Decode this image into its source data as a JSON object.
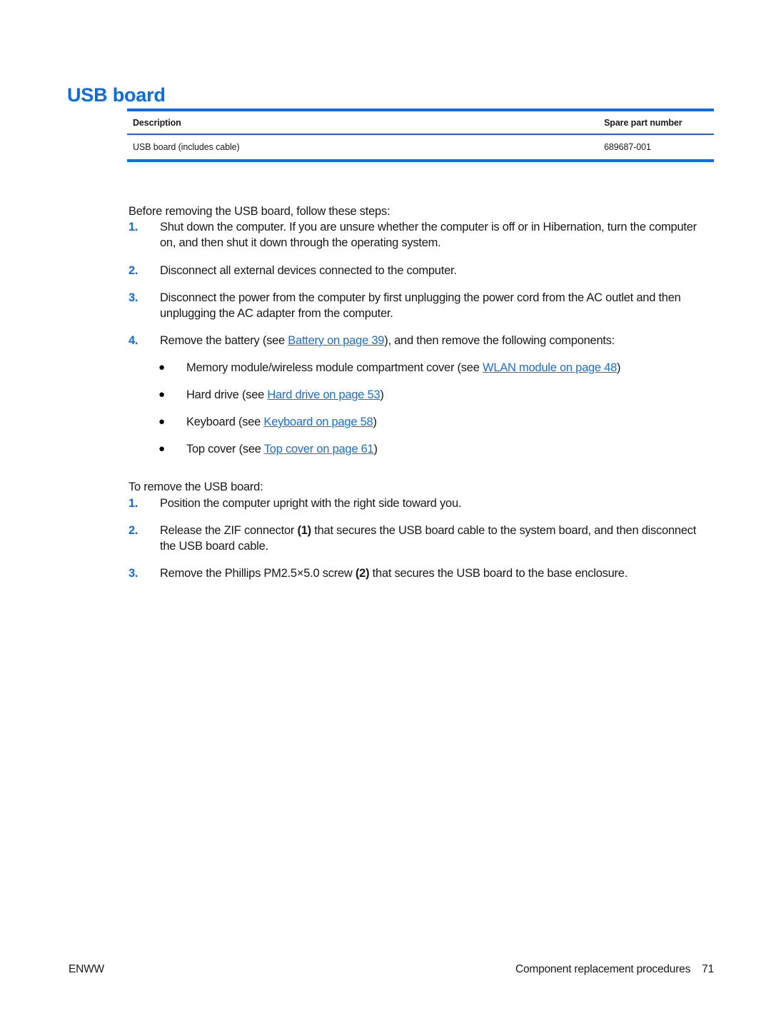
{
  "document": {
    "heading": "USB board"
  },
  "parts_table": {
    "columns": [
      "Description",
      "Spare part number"
    ],
    "rows": [
      {
        "description": "USB board (includes cable)",
        "spare_part_number": "689687-001"
      }
    ]
  },
  "prereq": {
    "intro": "Before removing the USB board, follow these steps:",
    "steps": [
      {
        "number": "1.",
        "text": "Shut down the computer. If you are unsure whether the computer is off or in Hibernation, turn the computer on, and then shut it down through the operating system."
      },
      {
        "number": "2.",
        "text": "Disconnect all external devices connected to the computer."
      },
      {
        "number": "3.",
        "text": "Disconnect the power from the computer by first unplugging the power cord from the AC outlet and then unplugging the AC adapter from the computer."
      },
      {
        "number": "4.",
        "text_before": "Remove the battery (see ",
        "link": "Battery on page 39",
        "text_after": "), and then remove the following components:"
      }
    ],
    "bullets": [
      {
        "marker": "●",
        "text_before": "Memory module/wireless module compartment cover (see ",
        "link": "WLAN module on page 48",
        "text_after": ")"
      },
      {
        "marker": "●",
        "text_before": "Hard drive (see ",
        "link": "Hard drive on page 53",
        "text_after": ")"
      },
      {
        "marker": "●",
        "text_before": "Keyboard (see ",
        "link": "Keyboard on page 58",
        "text_after": ")"
      },
      {
        "marker": "●",
        "text_before": "Top cover (see ",
        "link": "Top cover on page 61",
        "text_after": ")"
      }
    ]
  },
  "procedure": {
    "intro": "To remove the USB board:",
    "steps": [
      {
        "number": "1.",
        "text": "Position the computer upright with the right side toward you."
      },
      {
        "number": "2.",
        "text_before": "Release the ZIF connector ",
        "callout": "(1)",
        "text_after": " that secures the USB board cable to the system board, and then disconnect the USB board cable."
      },
      {
        "number": "3.",
        "text_before": "Remove the Phillips PM2.5×5.0 screw ",
        "callout": "(2)",
        "text_after": " that secures the USB board to the base enclosure."
      }
    ]
  },
  "footer": {
    "left": "ENWW",
    "section": "Component replacement procedures",
    "page_number": "71"
  },
  "colors": {
    "accent_blue": "#0B6BE8",
    "link_blue": "#1A6FE0",
    "body_text": "#191919"
  }
}
